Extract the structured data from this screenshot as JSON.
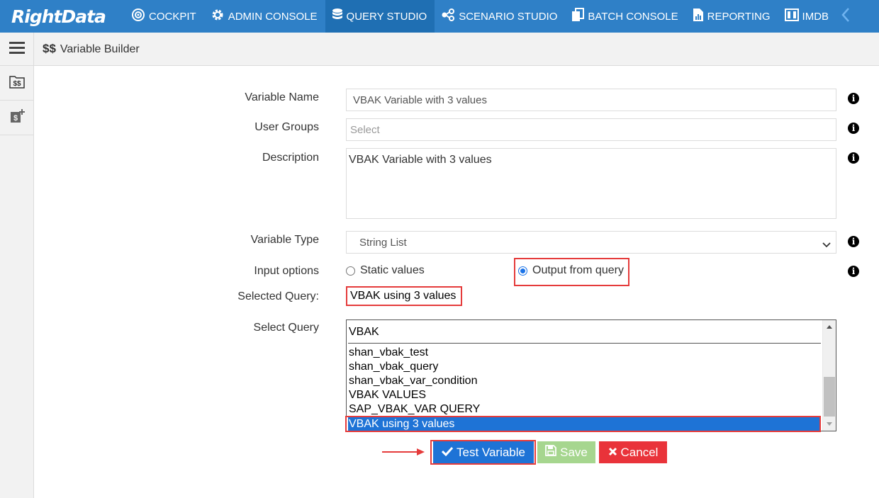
{
  "app": {
    "logo": "RightData"
  },
  "nav": {
    "items": [
      {
        "label": "COCKPIT",
        "icon": "cockpit-icon"
      },
      {
        "label": "ADMIN CONSOLE",
        "icon": "gear-icon"
      },
      {
        "label": "QUERY STUDIO",
        "icon": "database-icon",
        "active": true
      },
      {
        "label": "SCENARIO STUDIO",
        "icon": "scenario-icon"
      },
      {
        "label": "BATCH CONSOLE",
        "icon": "batch-icon"
      },
      {
        "label": "REPORTING",
        "icon": "report-icon"
      },
      {
        "label": "IMDB",
        "icon": "columns-icon"
      }
    ],
    "collapse_icon": "chevron-left-icon"
  },
  "subheader": {
    "icon_text": "$$",
    "title": "Variable Builder"
  },
  "sidebar": {
    "items": [
      {
        "icon": "variable-list-icon"
      },
      {
        "icon": "add-variable-icon"
      }
    ]
  },
  "form": {
    "variable_name": {
      "label": "Variable Name",
      "value": "VBAK Variable with 3 values"
    },
    "user_groups": {
      "label": "User Groups",
      "placeholder": "Select"
    },
    "description": {
      "label": "Description",
      "value": "VBAK Variable with 3 values"
    },
    "variable_type": {
      "label": "Variable Type",
      "value": "String List"
    },
    "input_options": {
      "label": "Input options",
      "options": [
        {
          "label": "Static values",
          "checked": false
        },
        {
          "label": "Output from query",
          "checked": true
        }
      ]
    },
    "selected_query": {
      "label": "Selected Query:",
      "value": "VBAK using 3 values"
    },
    "select_query": {
      "label": "Select Query",
      "search": "VBAK",
      "items": [
        "shan_vbak_test",
        "shan_vbak_query",
        "shan_vbak_var_condition",
        "VBAK VALUES",
        "SAP_VBAK_VAR QUERY",
        "VBAK using 3 values"
      ],
      "selected": "VBAK using 3 values"
    },
    "info_glyph": "i"
  },
  "buttons": {
    "test": "Test Variable",
    "save": "Save",
    "cancel": "Cancel"
  },
  "colors": {
    "nav_bg": "#2f80c7",
    "nav_active": "#1f6fb3",
    "primary_button": "#1e73d6",
    "save_button": "#a6d68f",
    "cancel_button": "#e9333a",
    "highlight": "#e53b3b"
  }
}
